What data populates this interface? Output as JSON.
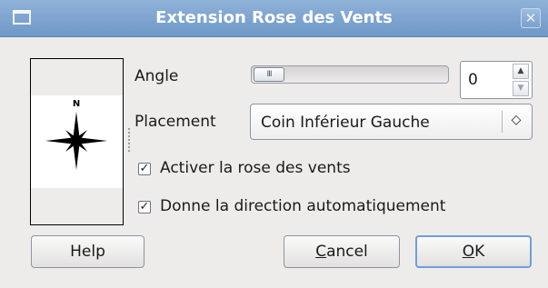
{
  "window": {
    "title": "Extension Rose des Vents",
    "close_glyph": "✕"
  },
  "preview": {
    "north_label": "N"
  },
  "angle": {
    "label": "Angle",
    "value": "0",
    "slider_fraction": 0.0,
    "slider_grip": "III"
  },
  "placement": {
    "label": "Placement",
    "selected": "Coin Inférieur Gauche",
    "arrow_glyph": "◇"
  },
  "checkboxes": [
    {
      "label": "Activer la rose des vents",
      "checked": true
    },
    {
      "label": "Donne la direction automatiquement",
      "checked": true
    }
  ],
  "buttons": {
    "help": "Help",
    "cancel": {
      "mnemonic": "C",
      "rest": "ancel"
    },
    "ok": {
      "mnemonic": "O",
      "rest": "K"
    }
  },
  "colors": {
    "titlebar": "#7fa6d2",
    "dialog_bg": "#edeceb",
    "default_button_border": "#6d9fd7"
  }
}
